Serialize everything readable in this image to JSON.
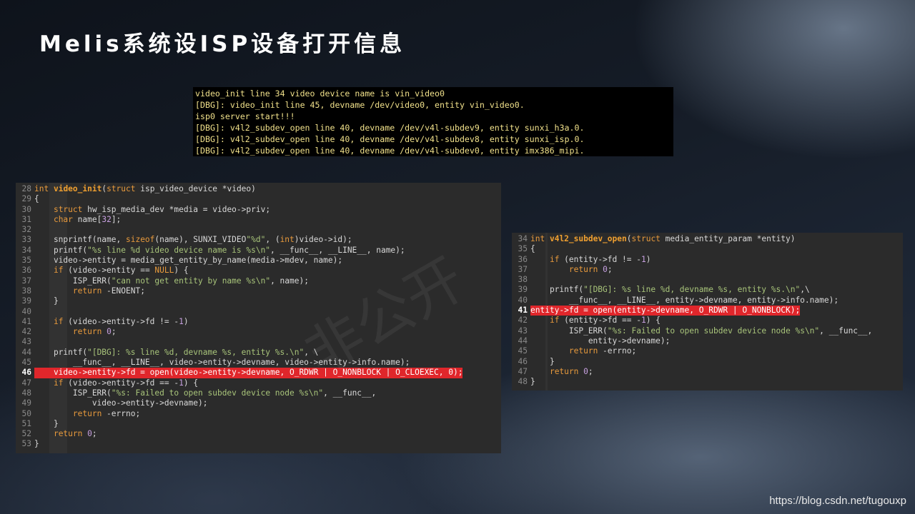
{
  "slide": {
    "title": "Melis系统设ISP设备打开信息",
    "watermark": "非公开",
    "credit": "https://blog.csdn.net/tugouxp"
  },
  "terminal": {
    "lines": [
      "video_init line 34 video device name is vin_video0",
      "[DBG]: video_init line 45, devname /dev/video0, entity vin_video0.",
      "isp0 server start!!!",
      "[DBG]: v4l2_subdev_open line 40, devname /dev/v4l-subdev9, entity sunxi_h3a.0.",
      "[DBG]: v4l2_subdev_open line 40, devname /dev/v4l-subdev8, entity sunxi_isp.0.",
      "[DBG]: v4l2_subdev_open line 40, devname /dev/v4l-subdev0, entity imx386_mipi."
    ]
  },
  "code_left": {
    "highlight_line": "46",
    "lines": [
      {
        "n": "28",
        "t": "int video_init(struct isp_video_device *video)"
      },
      {
        "n": "29",
        "t": "{"
      },
      {
        "n": "30",
        "t": "    struct hw_isp_media_dev *media = video->priv;"
      },
      {
        "n": "31",
        "t": "    char name[32];"
      },
      {
        "n": "32",
        "t": ""
      },
      {
        "n": "33",
        "t": "    snprintf(name, sizeof(name), SUNXI_VIDEO\"%d\", (int)video->id);"
      },
      {
        "n": "34",
        "t": "    printf(\"%s line %d video device name is %s\\n\", __func__, __LINE__, name);"
      },
      {
        "n": "35",
        "t": "    video->entity = media_get_entity_by_name(media->mdev, name);"
      },
      {
        "n": "36",
        "t": "    if (video->entity == NULL) {"
      },
      {
        "n": "37",
        "t": "        ISP_ERR(\"can not get entity by name %s\\n\", name);"
      },
      {
        "n": "38",
        "t": "        return -ENOENT;"
      },
      {
        "n": "39",
        "t": "    }"
      },
      {
        "n": "40",
        "t": ""
      },
      {
        "n": "41",
        "t": "    if (video->entity->fd != -1)"
      },
      {
        "n": "42",
        "t": "        return 0;"
      },
      {
        "n": "43",
        "t": ""
      },
      {
        "n": "44",
        "t": "    printf(\"[DBG]: %s line %d, devname %s, entity %s.\\n\", \\"
      },
      {
        "n": "45",
        "t": "        __func__, __LINE__, video->entity->devname, video->entity->info.name);"
      },
      {
        "n": "46",
        "t": "    video->entity->fd = open(video->entity->devname, O_RDWR | O_NONBLOCK | O_CLOEXEC, 0);"
      },
      {
        "n": "47",
        "t": "    if (video->entity->fd == -1) {"
      },
      {
        "n": "48",
        "t": "        ISP_ERR(\"%s: Failed to open subdev device node %s\\n\", __func__,"
      },
      {
        "n": "49",
        "t": "            video->entity->devname);"
      },
      {
        "n": "50",
        "t": "        return -errno;"
      },
      {
        "n": "51",
        "t": "    }"
      },
      {
        "n": "52",
        "t": "    return 0;"
      },
      {
        "n": "53",
        "t": "}"
      }
    ]
  },
  "code_right": {
    "highlight_line": "41",
    "lines": [
      {
        "n": "34",
        "t": "int v4l2_subdev_open(struct media_entity_param *entity)"
      },
      {
        "n": "35",
        "t": "{"
      },
      {
        "n": "36",
        "t": "    if (entity->fd != -1)"
      },
      {
        "n": "37",
        "t": "        return 0;"
      },
      {
        "n": "38",
        "t": ""
      },
      {
        "n": "39",
        "t": "    printf(\"[DBG]: %s line %d, devname %s, entity %s.\\n\",\\"
      },
      {
        "n": "40",
        "t": "        __func__, __LINE__, entity->devname, entity->info.name);"
      },
      {
        "n": "41",
        "t": "entity->fd = open(entity->devname, O_RDWR | O_NONBLOCK);"
      },
      {
        "n": "42",
        "t": "    if (entity->fd == -1) {"
      },
      {
        "n": "43",
        "t": "        ISP_ERR(\"%s: Failed to open subdev device node %s\\n\", __func__,"
      },
      {
        "n": "44",
        "t": "            entity->devname);"
      },
      {
        "n": "45",
        "t": "        return -errno;"
      },
      {
        "n": "46",
        "t": "    }"
      },
      {
        "n": "47",
        "t": "    return 0;"
      },
      {
        "n": "48",
        "t": "}"
      }
    ]
  },
  "colors": {
    "keyword": "#e89a3c",
    "type": "#e89a3c",
    "string": "#a8c47a",
    "number": "#c7a0e0",
    "function": "#f0a030",
    "highlight": "#e0262b",
    "terminal_text": "#f0e08a"
  }
}
